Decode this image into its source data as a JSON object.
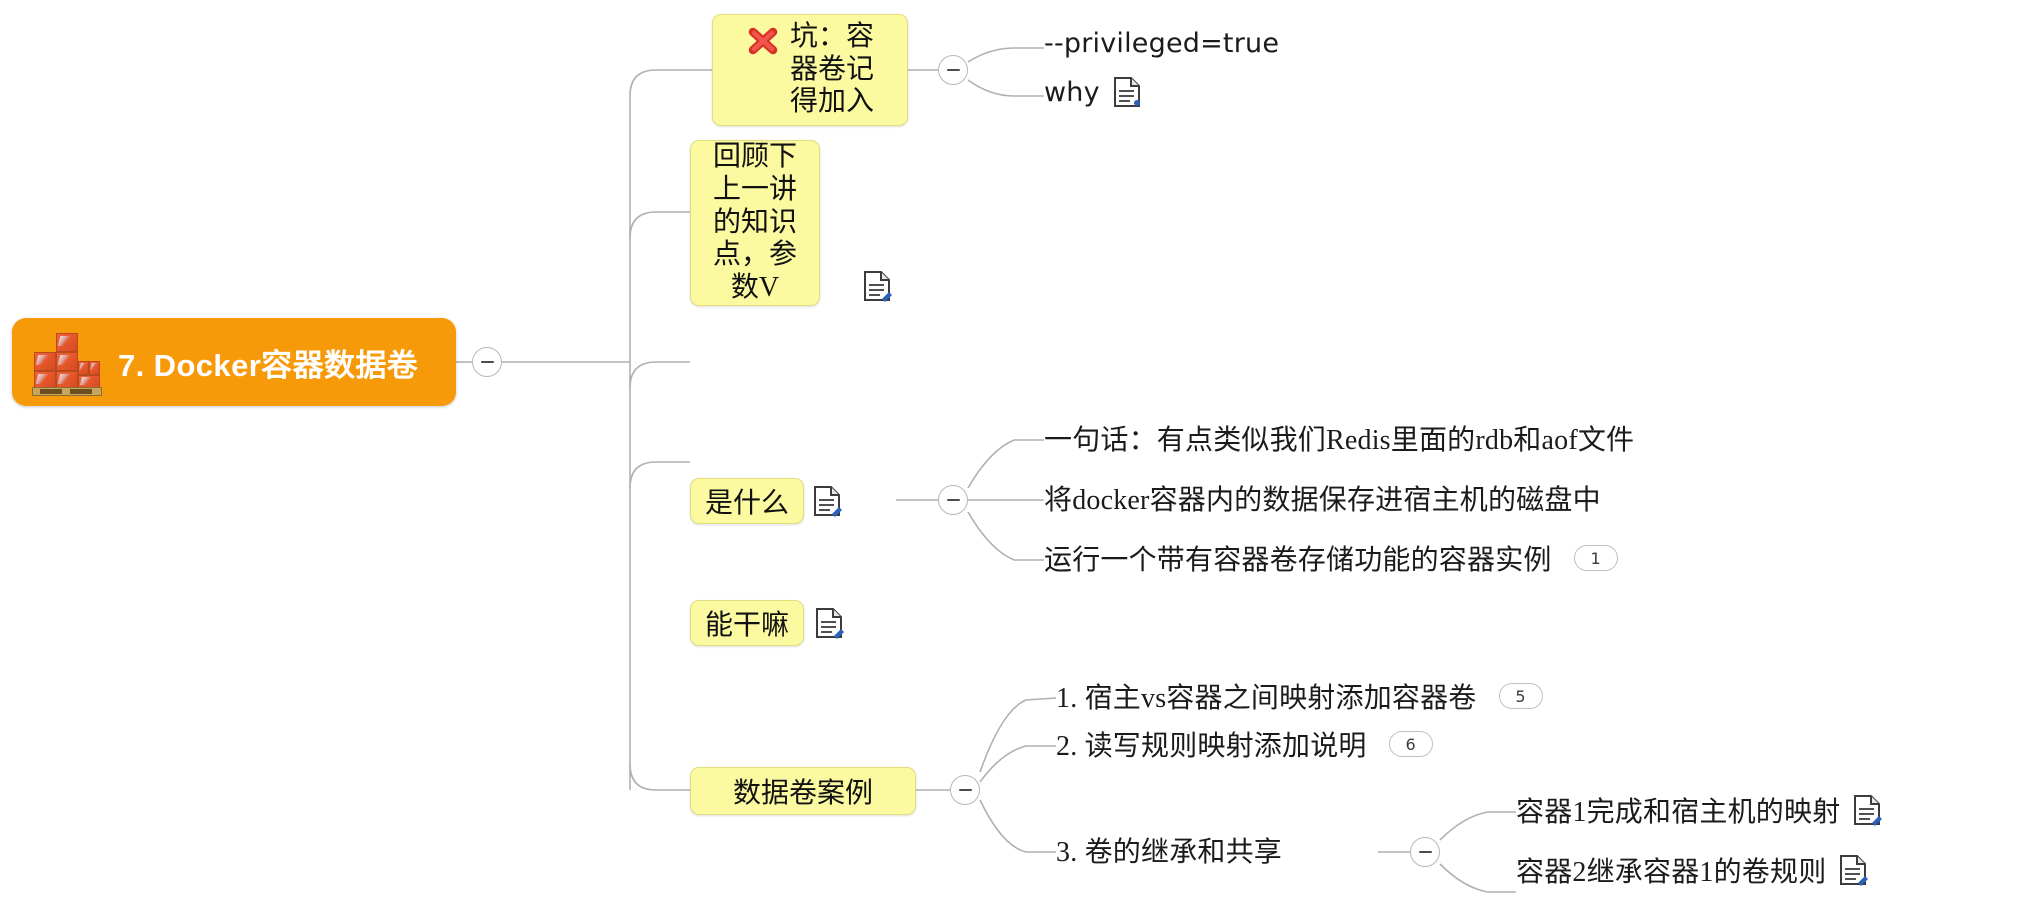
{
  "document": {
    "type": "mindmap",
    "background": "#ffffff",
    "connector_color": "#b0b0b0"
  },
  "root": {
    "label": "7. Docker容器数据卷",
    "icon": "stacked-crates-icon",
    "background": "#F79A0A",
    "text_color": "#ffffff"
  },
  "style": {
    "topic_fill": "#FCFAA0",
    "topic_border": "#e2dd7d",
    "badge_border": "#c2c2c2",
    "note_icon_accent": "#2b5fb8"
  },
  "branches": [
    {
      "id": "pitfall",
      "label": "坑：容器卷记得加入",
      "label_lines": [
        "坑：容",
        "器卷记",
        "得加入"
      ],
      "emoji": "cross-mark-icon",
      "boxed": true,
      "toggle": "minus",
      "children": [
        {
          "label": "--privileged=true",
          "latin": true,
          "note": false,
          "badge": null
        },
        {
          "label": "why",
          "latin": true,
          "note": true,
          "badge": null
        }
      ]
    },
    {
      "id": "review",
      "label": "回顾下上一讲的知识点，参数V",
      "label_lines": [
        "回顾下",
        "上一讲",
        "的知识",
        "点，参",
        "数V"
      ],
      "boxed": true,
      "note": true,
      "toggle": null,
      "children": []
    },
    {
      "id": "what-is-it",
      "label": "是什么",
      "boxed": true,
      "note": true,
      "toggle": "minus",
      "children": [
        {
          "label": "一句话：有点类似我们Redis里面的rdb和aof文件",
          "note": false,
          "badge": null
        },
        {
          "label": "将docker容器内的数据保存进宿主机的磁盘中",
          "note": false,
          "badge": null
        },
        {
          "label": "运行一个带有容器卷存储功能的容器实例",
          "note": false,
          "badge": "1"
        }
      ]
    },
    {
      "id": "what-can-it-do",
      "label": "能干嘛",
      "boxed": true,
      "note": true,
      "toggle": null,
      "children": []
    },
    {
      "id": "volume-cases",
      "label": "数据卷案例",
      "boxed": true,
      "note": false,
      "toggle": "minus",
      "children": [
        {
          "label": "1. 宿主vs容器之间映射添加容器卷",
          "note": false,
          "badge": "5"
        },
        {
          "label": "2. 读写规则映射添加说明",
          "note": false,
          "badge": "6"
        },
        {
          "label": "3. 卷的继承和共享",
          "note": false,
          "badge": null,
          "toggle": "minus",
          "children": [
            {
              "label": "容器1完成和宿主机的映射",
              "note": true,
              "badge": null
            },
            {
              "label": "容器2继承容器1的卷规则",
              "note": true,
              "badge": null
            }
          ]
        }
      ]
    }
  ]
}
